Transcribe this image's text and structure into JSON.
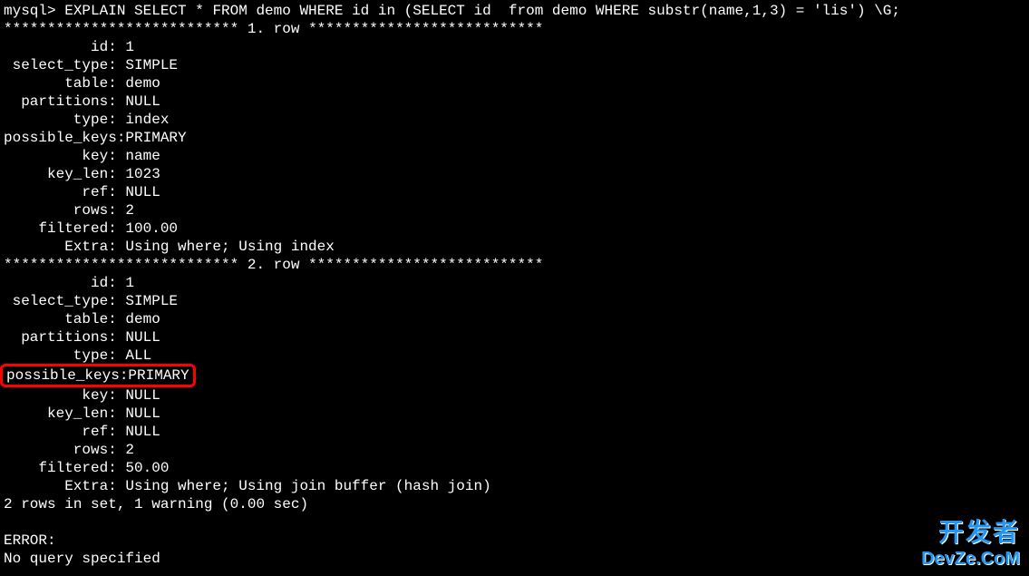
{
  "prompt": "mysql> EXPLAIN SELECT * FROM demo WHERE id in (SELECT id  from demo WHERE substr(name,1,3) = 'lis') \\G;",
  "divider_prefix": "***************************",
  "row1_label": " 1. row ",
  "row2_label": " 2. row ",
  "divider_suffix": "***************************",
  "row1": {
    "id": {
      "label": "id:",
      "value": "1"
    },
    "select_type": {
      "label": "select_type:",
      "value": "SIMPLE"
    },
    "table": {
      "label": "table:",
      "value": "demo"
    },
    "partitions": {
      "label": "partitions:",
      "value": "NULL"
    },
    "type": {
      "label": "type:",
      "value": "index"
    },
    "possible_keys": {
      "label": "possible_keys:",
      "value": "PRIMARY"
    },
    "key": {
      "label": "key:",
      "value": "name"
    },
    "key_len": {
      "label": "key_len:",
      "value": "1023"
    },
    "ref": {
      "label": "ref:",
      "value": "NULL"
    },
    "rows": {
      "label": "rows:",
      "value": "2"
    },
    "filtered": {
      "label": "filtered:",
      "value": "100.00"
    },
    "extra": {
      "label": "Extra:",
      "value": "Using where; Using index"
    }
  },
  "row2": {
    "id": {
      "label": "id:",
      "value": "1"
    },
    "select_type": {
      "label": "select_type:",
      "value": "SIMPLE"
    },
    "table": {
      "label": "table:",
      "value": "demo"
    },
    "partitions": {
      "label": "partitions:",
      "value": "NULL"
    },
    "type": {
      "label": "type:",
      "value": "ALL"
    },
    "possible_keys": {
      "label": "possible_keys:",
      "value": "PRIMARY"
    },
    "key": {
      "label": "key:",
      "value": "NULL"
    },
    "key_len": {
      "label": "key_len:",
      "value": "NULL"
    },
    "ref": {
      "label": "ref:",
      "value": "NULL"
    },
    "rows": {
      "label": "rows:",
      "value": "2"
    },
    "filtered": {
      "label": "filtered:",
      "value": "50.00"
    },
    "extra": {
      "label": "Extra:",
      "value": "Using where; Using join buffer (hash join)"
    }
  },
  "summary": "2 rows in set, 1 warning (0.00 sec)",
  "error_label": "ERROR:",
  "error_msg": "No query specified",
  "watermark_cn": "开发者",
  "watermark_en": "DevZe.CoM"
}
